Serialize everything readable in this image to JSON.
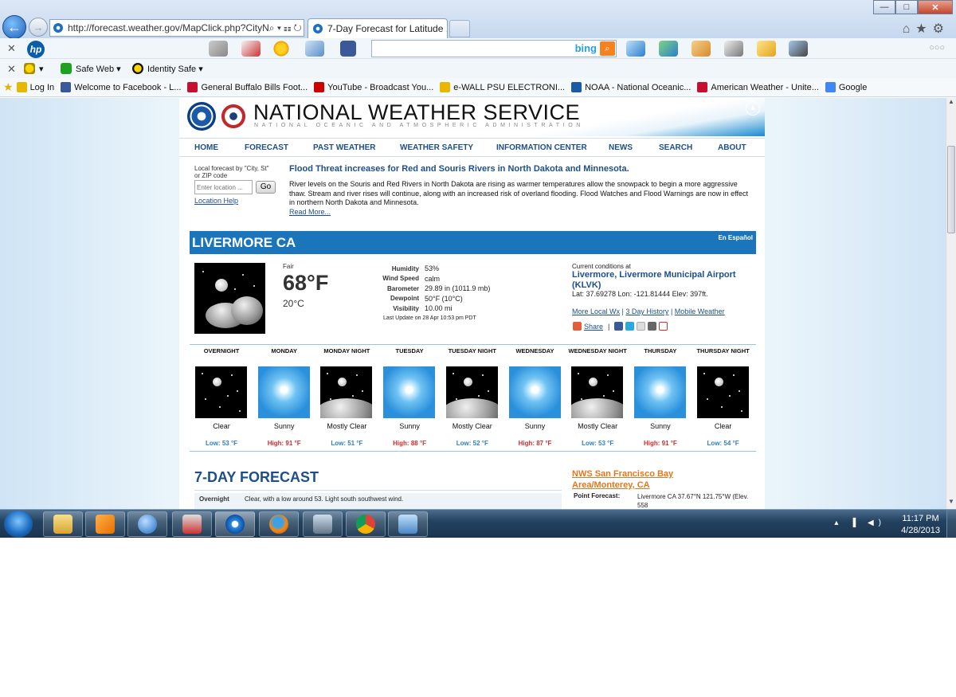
{
  "browser": {
    "address": "http://forecast.weather.gov/MapClick.php?CityN",
    "address_ctrls": "⌕ ▾ ☷ ↻ ✕",
    "tab_title": "7-Day Forecast for Latitude ...",
    "tab_close": "✕",
    "win_min": "—",
    "win_max": "□",
    "win_close": "✕",
    "right_icons": "⌂★⚙",
    "back": "←",
    "forward": "→"
  },
  "toolbar": {
    "close": "✕",
    "hp": "hp",
    "bing": "bing",
    "bing_btn": "⌕",
    "dots": "○○○",
    "safe_web": "Safe Web ▾",
    "identity_safe": "Identity Safe ▾",
    "norton_check": "▾"
  },
  "favorites": [
    {
      "label": "Log In",
      "color": "#e6b800"
    },
    {
      "label": "Welcome to Facebook - L...",
      "color": "#3b5998"
    },
    {
      "label": "General Buffalo Bills Foot...",
      "color": "#c8102e"
    },
    {
      "label": "YouTube - Broadcast You...",
      "color": "#cc0000"
    },
    {
      "label": "e-WALL  PSU ELECTRONI...",
      "color": "#e6b800"
    },
    {
      "label": "NOAA - National Oceanic...",
      "color": "#1b5aa6"
    },
    {
      "label": "American Weather - Unite...",
      "color": "#c8102e"
    },
    {
      "label": "Google",
      "color": "#4285f4"
    }
  ],
  "nws": {
    "title": "NATIONAL WEATHER SERVICE",
    "subtitle": "NATIONAL OCEANIC AND ATMOSPHERIC ADMINISTRATION",
    "nav": [
      "HOME",
      "FORECAST",
      "PAST WEATHER",
      "WEATHER SAFETY",
      "INFORMATION CENTER",
      "NEWS",
      "SEARCH",
      "ABOUT"
    ]
  },
  "local": {
    "label": "Local forecast by \"City, St\" or ZIP code",
    "placeholder": "Enter location ...",
    "go": "Go",
    "help": "Location Help"
  },
  "news": {
    "title": "Flood Threat increases for Red and Souris Rivers in North Dakota and Minnesota.",
    "body": "River levels on the Souris and Red Rivers in North Dakota are rising as warmer temperatures allow the snowpack to begin a more aggressive thaw. Stream and river rises will continue, along with an increased risk of overland flooding. Flood Watches and Flood Warnings are now in effect in northern North Dakota and Minnesota.",
    "more": "Read More..."
  },
  "location": {
    "city": "LIVERMORE CA",
    "espanol": "En Español"
  },
  "current": {
    "condition": "Fair",
    "temp_f": "68°F",
    "temp_c": "20°C",
    "details": [
      {
        "label": "Humidity",
        "value": "53%"
      },
      {
        "label": "Wind Speed",
        "value": "calm"
      },
      {
        "label": "Barometer",
        "value": "29.89 in (1011.9 mb)"
      },
      {
        "label": "Dewpoint",
        "value": "50°F (10°C)"
      },
      {
        "label": "Visibility",
        "value": "10.00 mi"
      }
    ],
    "last_update": "Last Update on 28 Apr 10:53 pm PDT",
    "station_label": "Current conditions at",
    "station": "Livermore, Livermore Municipal Airport (KLVK)",
    "latlon": "Lat: 37.69278 Lon: -121.81444 Elev: 397ft.",
    "link_local": "More Local Wx",
    "link_history": "3 Day History",
    "link_mobile": "Mobile Weather",
    "sep": "|",
    "share": "Share",
    "share_sep": "|"
  },
  "forecast": [
    {
      "name": "OVERNIGHT",
      "icon": "night",
      "desc": "Clear",
      "temp": "Low: 53 °F",
      "kind": "lo"
    },
    {
      "name": "MONDAY",
      "icon": "sunny",
      "desc": "Sunny",
      "temp": "High: 91 °F",
      "kind": "hi"
    },
    {
      "name": "MONDAY NIGHT",
      "icon": "pnight",
      "desc": "Mostly Clear",
      "temp": "Low: 51 °F",
      "kind": "lo"
    },
    {
      "name": "TUESDAY",
      "icon": "sunny",
      "desc": "Sunny",
      "temp": "High: 88 °F",
      "kind": "hi"
    },
    {
      "name": "TUESDAY NIGHT",
      "icon": "pnight",
      "desc": "Mostly Clear",
      "temp": "Low: 52 °F",
      "kind": "lo"
    },
    {
      "name": "WEDNESDAY",
      "icon": "sunny",
      "desc": "Sunny",
      "temp": "High: 87 °F",
      "kind": "hi"
    },
    {
      "name": "WEDNESDAY NIGHT",
      "icon": "pnight",
      "desc": "Mostly Clear",
      "temp": "Low: 53 °F",
      "kind": "lo"
    },
    {
      "name": "THURSDAY",
      "icon": "sunny",
      "desc": "Sunny",
      "temp": "High: 91 °F",
      "kind": "hi"
    },
    {
      "name": "THURSDAY NIGHT",
      "icon": "night",
      "desc": "Clear",
      "temp": "Low: 54 °F",
      "kind": "lo"
    }
  ],
  "seven_day": {
    "title": "7-DAY FORECAST",
    "first_label": "Overnight",
    "first_text": "Clear, with a low around 53. Light south southwest wind."
  },
  "office": {
    "link": "NWS San Francisco Bay Area/Monterey, CA",
    "pf_label": "Point Forecast:",
    "pf_value": "Livermore CA 37.67°N 121.75°W (Elev. 558"
  },
  "taskbar": {
    "tray": "▴ ▐ ◀)",
    "time": "11:17 PM",
    "date": "4/28/2013"
  }
}
